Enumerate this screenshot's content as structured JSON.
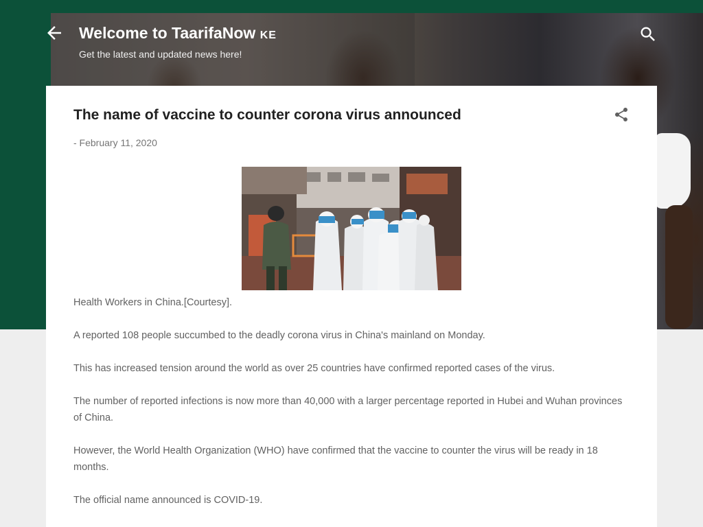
{
  "header": {
    "title": "Welcome to TaarifaNow",
    "title_suffix": "KE",
    "description": "Get the latest and updated news here!",
    "back_icon": "arrow-left-icon",
    "search_icon": "search-icon",
    "background_color": "#0c5139"
  },
  "post": {
    "title": "The name of vaccine to counter corona virus announced",
    "date": "- February 11, 2020",
    "share_icon": "share-icon",
    "image_alt": "Health workers in protective suits",
    "paragraphs": [
      "Health Workers in China.[Courtesy].",
      "A reported 108 people succumbed to the deadly corona virus in China's mainland on Monday.",
      "This has increased tension around the world as over 25 countries have confirmed reported cases of the virus.",
      "The number of reported infections is now more than 40,000 with a larger percentage reported in Hubei and Wuhan provinces of China.",
      "However, the World Health Organization (WHO) have confirmed that the vaccine to counter the virus will be ready in 18 months.",
      "The official name announced is COVID-19."
    ]
  },
  "colors": {
    "title_text": "#212121",
    "body_text": "#616161",
    "meta_text": "#757575",
    "page_background": "#eeeeee"
  }
}
